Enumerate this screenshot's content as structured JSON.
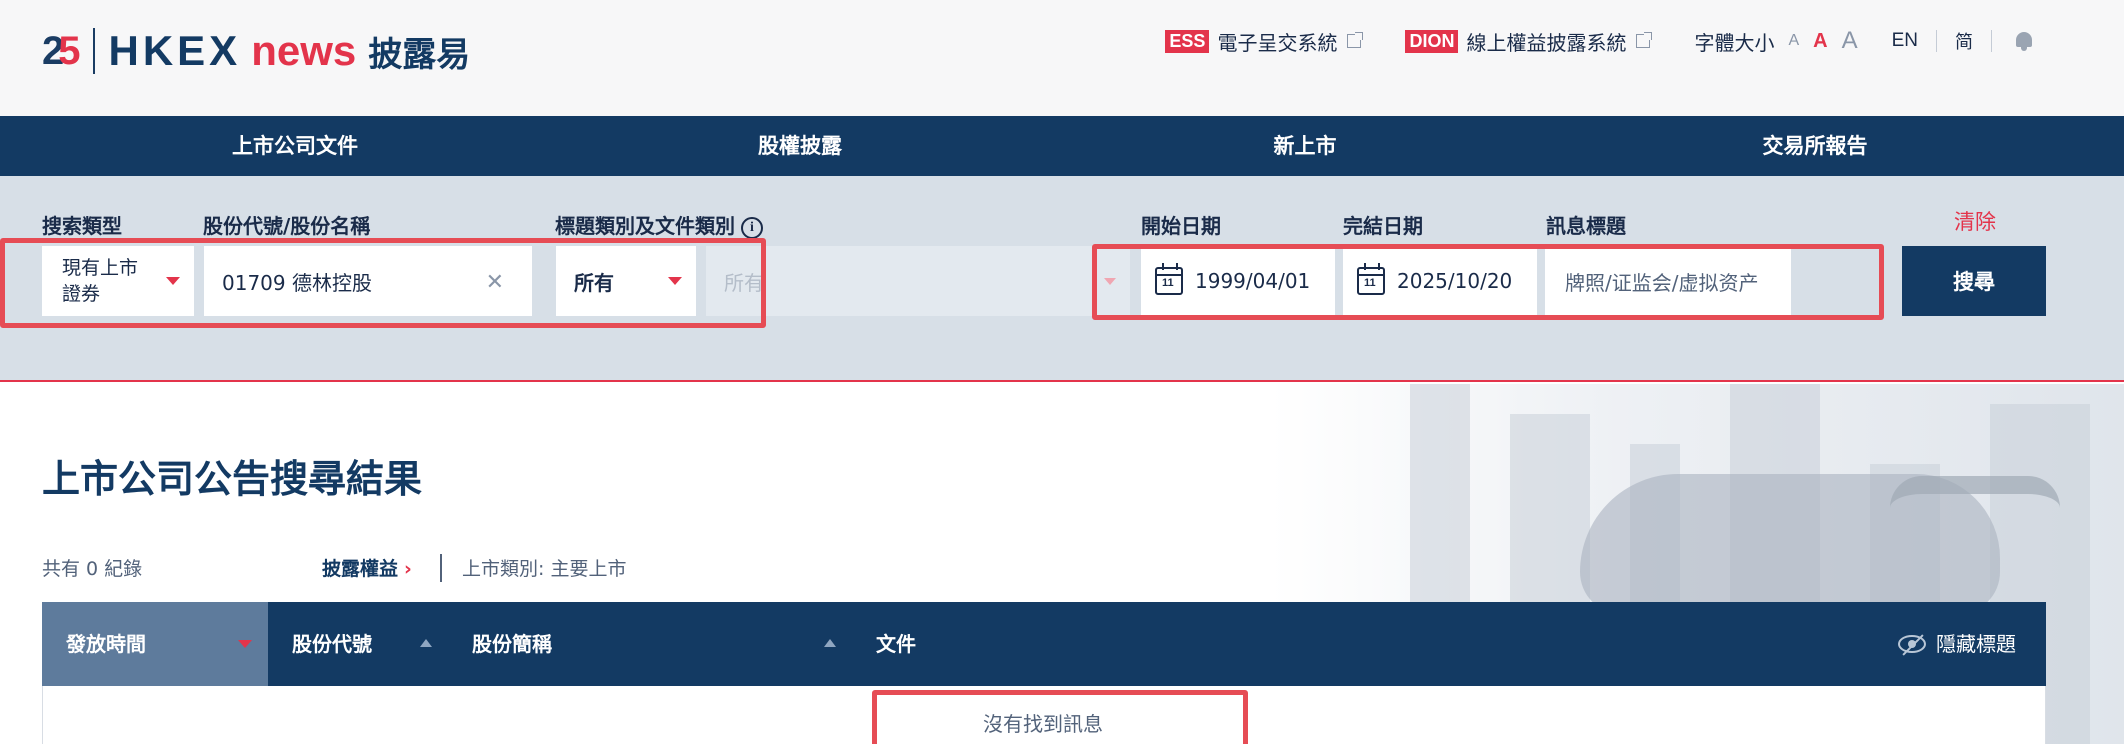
{
  "header": {
    "logo": {
      "num_a": "2",
      "num_b": "5",
      "brand": "HKEX",
      "news": "news",
      "zh": "披露易"
    },
    "ess": {
      "tag": "ESS",
      "label": "電子呈交系統"
    },
    "dion": {
      "tag": "DION",
      "label": "線上權益披露系統"
    },
    "font_size_label": "字體大小",
    "font_sizes": [
      "A",
      "A",
      "A"
    ],
    "lang_en": "EN",
    "lang_sc": "简"
  },
  "nav": {
    "items": [
      "上市公司文件",
      "股權披露",
      "新上市",
      "交易所報告"
    ]
  },
  "search": {
    "labels": {
      "search_type": "搜索類型",
      "stock": "股份代號/股份名稱",
      "category": "標題類別及文件類別",
      "start_date": "開始日期",
      "end_date": "完結日期",
      "title": "訊息標題"
    },
    "clear": "清除",
    "search_type_value": "現有上市\n證券",
    "stock_value": "01709 德林控股",
    "category_value": "所有",
    "doc_type_placeholder": "所有",
    "start_date": "1999/04/01",
    "end_date": "2025/10/20",
    "title_value": "牌照/证监会/虚拟资产",
    "button": "搜尋"
  },
  "results": {
    "title": "上市公司公告搜尋結果",
    "count": "共有 0 紀錄",
    "filter_chip": "披露權益",
    "filter_info": "上市類別: 主要上市",
    "columns": [
      "發放時間",
      "股份代號",
      "股份簡稱",
      "文件"
    ],
    "hide_titles": "隱藏標題",
    "empty": "沒有找到訊息"
  },
  "colors": {
    "navy": "#133a63",
    "red": "#e3344b",
    "panel": "#d7dfe7",
    "highlight": "#e64c55"
  }
}
